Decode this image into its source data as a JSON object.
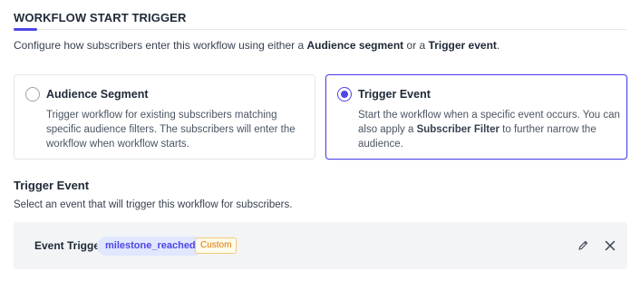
{
  "header": {
    "title": "WORKFLOW START TRIGGER",
    "intro_prefix": "Configure how subscribers enter this workflow using either a ",
    "intro_bold_1": "Audience segment",
    "intro_middle": " or a ",
    "intro_bold_2": "Trigger event",
    "intro_suffix": "."
  },
  "options": {
    "audience": {
      "title": "Audience Segment",
      "description": "Trigger workflow for existing subscribers matching specific audience filters. The subscribers will enter the workflow when workflow starts.",
      "selected": false
    },
    "trigger": {
      "title": "Trigger Event",
      "desc_prefix": "Start the workflow when a specific event occurs. You can also apply a ",
      "desc_bold": "Subscriber Filter",
      "desc_suffix": " to further narrow the audience.",
      "selected": true
    }
  },
  "trigger_event": {
    "title": "Trigger Event",
    "description": "Select an event that will trigger this workflow for subscribers.",
    "label": "Event Trigger",
    "event_name": "milestone_reached",
    "badge": "Custom"
  },
  "colors": {
    "accent": "#4f46e5",
    "chip_bg": "#e0e7ff",
    "badge_text": "#d97706",
    "badge_border": "#f5c97a",
    "panel_bg": "#f3f4f6"
  },
  "icons": {
    "edit": "pencil-icon",
    "remove": "close-icon"
  }
}
